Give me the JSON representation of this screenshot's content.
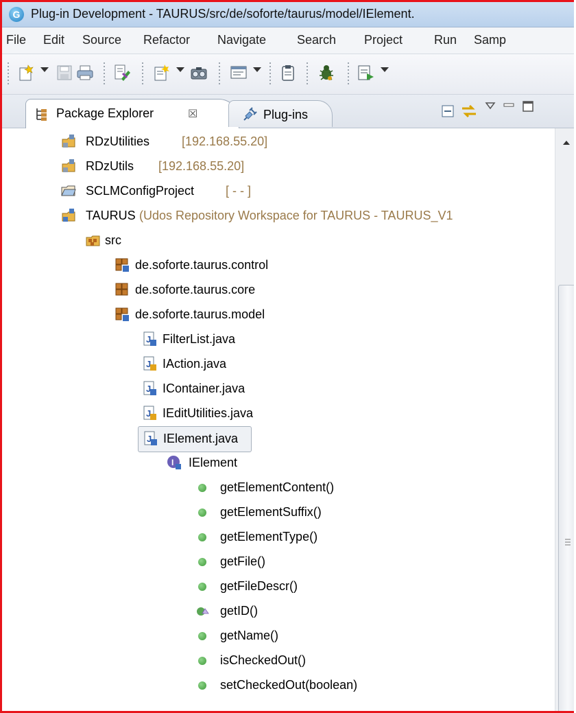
{
  "window": {
    "title": "Plug-in Development - TAURUS/src/de/soforte/taurus/model/IElement."
  },
  "menu": [
    "File",
    "Edit",
    "Source",
    "Refactor",
    "Navigate",
    "Search",
    "Project",
    "Run",
    "Samp"
  ],
  "toolbar": {
    "icons": [
      "new-wizard-icon",
      "save-icon",
      "print-icon",
      "marker-icon",
      "new-java-icon",
      "camera-icon",
      "console-icon",
      "clipboard-icon",
      "bug-icon",
      "external-tools-icon"
    ]
  },
  "views": {
    "active_tab": "Package Explorer",
    "active_close": "☒",
    "inactive_tab": "Plug-ins"
  },
  "tree": {
    "items": [
      {
        "label": "RDzUtilities",
        "decoration": "[192.168.55.20]",
        "icon": "remote-project-icon"
      },
      {
        "label": "RDzUtils",
        "decoration": "[192.168.55.20]",
        "icon": "remote-project-icon"
      },
      {
        "label": "SCLMConfigProject",
        "decoration": "[ - - ]",
        "icon": "folder-project-icon"
      },
      {
        "label": "TAURUS",
        "decoration": "(Udos Repository Workspace for TAURUS - TAURUS_V1",
        "icon": "repository-project-icon"
      },
      {
        "label": "src",
        "icon": "source-folder-icon"
      },
      {
        "label": "de.soforte.taurus.control",
        "icon": "package-icon"
      },
      {
        "label": "de.soforte.taurus.core",
        "icon": "package-icon"
      },
      {
        "label": "de.soforte.taurus.model",
        "icon": "package-icon"
      },
      {
        "label": "FilterList.java",
        "icon": "java-file-icon"
      },
      {
        "label": "IAction.java",
        "icon": "java-file-icon"
      },
      {
        "label": "IContainer.java",
        "icon": "java-file-icon"
      },
      {
        "label": "IEditUtilities.java",
        "icon": "java-file-icon"
      },
      {
        "label": "IElement.java",
        "icon": "java-file-icon"
      },
      {
        "label": "IElement",
        "icon": "interface-icon"
      },
      {
        "label": "getElementContent()",
        "icon": "method-icon"
      },
      {
        "label": "getElementSuffix()",
        "icon": "method-icon"
      },
      {
        "label": "getElementType()",
        "icon": "method-icon"
      },
      {
        "label": "getFile()",
        "icon": "method-icon"
      },
      {
        "label": "getFileDescr()",
        "icon": "method-icon"
      },
      {
        "label": "getID()",
        "icon": "method-icon"
      },
      {
        "label": "getName()",
        "icon": "method-icon"
      },
      {
        "label": "isCheckedOut()",
        "icon": "method-icon"
      },
      {
        "label": "setCheckedOut(boolean)",
        "icon": "method-icon"
      }
    ]
  },
  "colors": {
    "frame": "#e8141b",
    "decoration_text": "#9a7a4a"
  }
}
